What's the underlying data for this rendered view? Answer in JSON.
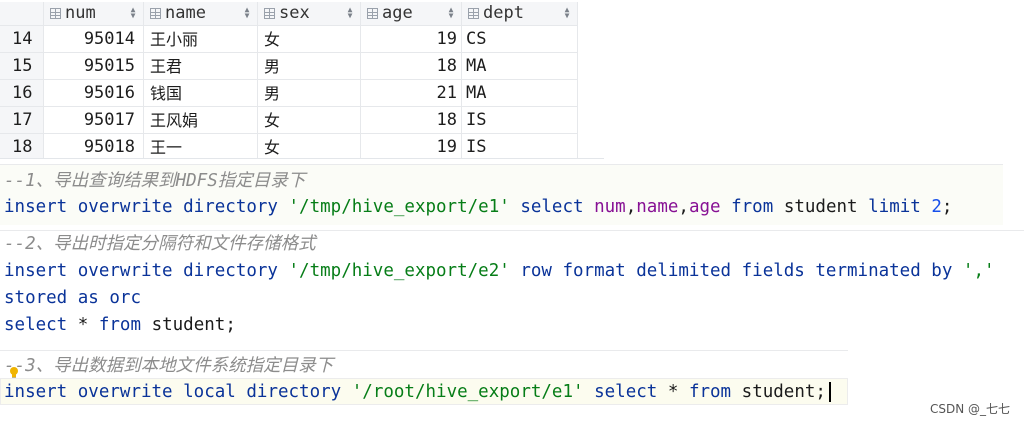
{
  "grid": {
    "columns": [
      "num",
      "name",
      "sex",
      "age",
      "dept"
    ],
    "rows": [
      {
        "idx": "14",
        "num": "95014",
        "name": "王小丽",
        "sex": "女",
        "age": "19",
        "dept": "CS"
      },
      {
        "idx": "15",
        "num": "95015",
        "name": "王君",
        "sex": "男",
        "age": "18",
        "dept": "MA"
      },
      {
        "idx": "16",
        "num": "95016",
        "name": "钱国",
        "sex": "男",
        "age": "21",
        "dept": "MA"
      },
      {
        "idx": "17",
        "num": "95017",
        "name": "王风娟",
        "sex": "女",
        "age": "18",
        "dept": "IS"
      },
      {
        "idx": "18",
        "num": "95018",
        "name": "王一",
        "sex": "女",
        "age": "19",
        "dept": "IS"
      }
    ]
  },
  "editor": {
    "comment1": "--1、导出查询结果到HDFS指定目录下",
    "line1": {
      "insert": "insert",
      "overwrite": "overwrite",
      "directory": "directory",
      "path": "'/tmp/hive_export/e1'",
      "select": "select",
      "c1": "num",
      "c2": "name",
      "c3": "age",
      "comma": ",",
      "from": "from",
      "table": "student",
      "limit": "limit",
      "n": "2",
      "semi": ";"
    },
    "comment2": "--2、导出时指定分隔符和文件存储格式",
    "line2": {
      "insert": "insert",
      "overwrite": "overwrite",
      "directory": "directory",
      "path": "'/tmp/hive_export/e2'",
      "row": "row",
      "format": "format",
      "delimited": "delimited",
      "fields": "fields",
      "terminated": "terminated",
      "by": "by",
      "sep": "','"
    },
    "line3": {
      "stored": "stored",
      "as": "as",
      "orc": "orc"
    },
    "line4": {
      "select": "select",
      "star": "*",
      "from": "from",
      "table": "student",
      "semi": ";"
    },
    "comment3_prefix": "-",
    "comment3": "-3、导出数据到本地文件系统指定目录下",
    "line5": {
      "insert": "insert",
      "overwrite": "overwrite",
      "local": "local",
      "directory": "directory",
      "path": "'/root/hive_export/e1'",
      "select": "select",
      "star": "*",
      "from": "from",
      "table": "student",
      "semi": ";"
    }
  },
  "watermark": "CSDN @_七七",
  "colors": {
    "keyword": "#0a3399",
    "string": "#067d17",
    "column": "#871094",
    "number": "#1750eb",
    "comment": "#8c8c8c"
  }
}
